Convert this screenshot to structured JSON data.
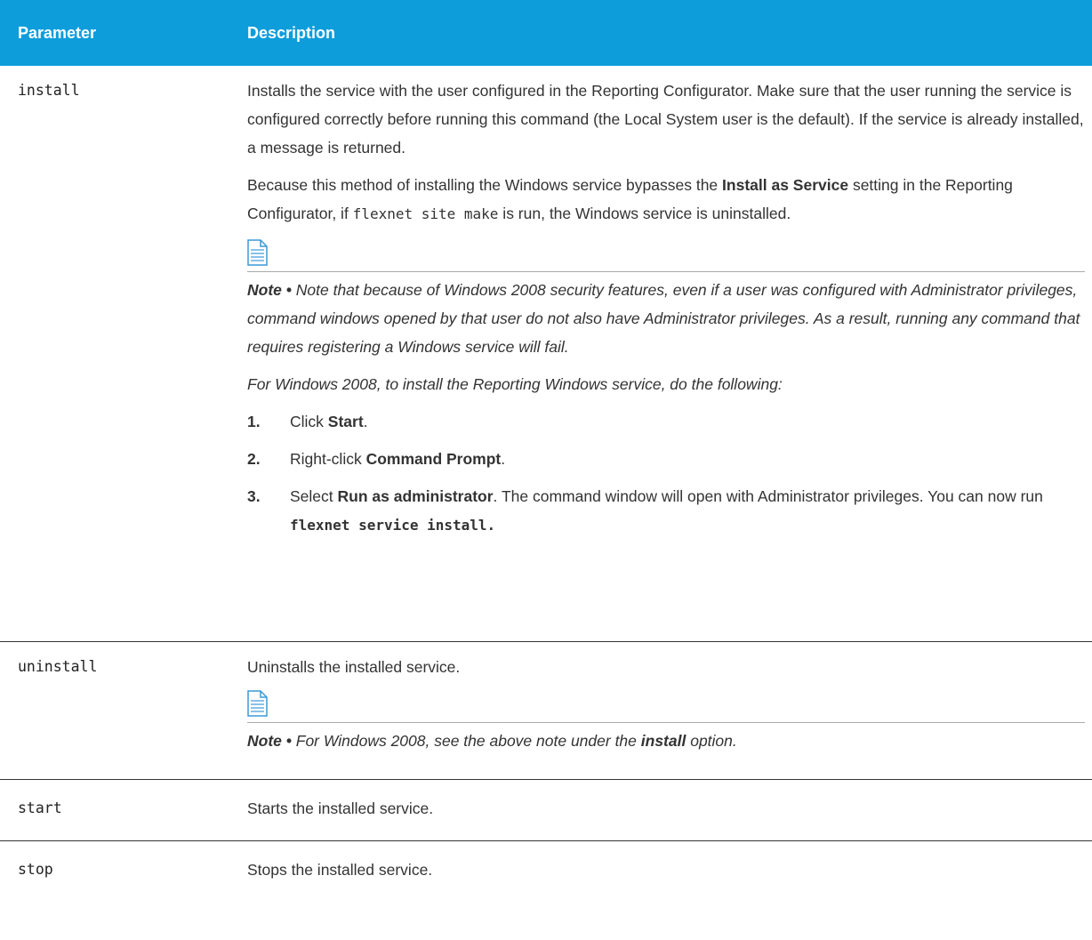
{
  "header": {
    "col1": "Parameter",
    "col2": "Description"
  },
  "rows": [
    {
      "param": "install",
      "p1": "Installs the service with the user configured in the Reporting Configurator. Make sure that the user running the service is configured correctly before running this command (the Local System user is the default). If the service is already installed, a message is returned.",
      "p2_a": "Because this method of installing the Windows service bypasses the ",
      "p2_b": "Install as Service",
      "p2_c": " setting in the Reporting Configurator, if ",
      "p2_code": "flexnet site make",
      "p2_d": " is run, the Windows service is uninstalled.",
      "note_label": "Note •",
      "note_text": " Note that because of Windows 2008 security features, even if a user was configured with Administrator privileges, command windows opened by that user do not also have Administrator privileges. As a result, running any command that requires registering a Windows service will fail.",
      "note_sub": "For Windows 2008, to install the Reporting Windows service, do the following:",
      "steps": [
        {
          "num": "1.",
          "a": "Click ",
          "b": "Start",
          "c": "."
        },
        {
          "num": "2.",
          "a": "Right-click ",
          "b": "Command Prompt",
          "c": "."
        },
        {
          "num": "3.",
          "a": "Select ",
          "b": "Run as administrator",
          "c": ". The command window will open with Administrator privileges. You can now run ",
          "code": "flexnet service install."
        }
      ]
    },
    {
      "param": "uninstall",
      "p1": "Uninstalls the installed service.",
      "note_label": "Note •",
      "note_a": " For Windows 2008, see the above note under the ",
      "note_b": "install",
      "note_c": " option."
    },
    {
      "param": "start",
      "p1": "Starts the installed service."
    },
    {
      "param": "stop",
      "p1": "Stops the installed service."
    }
  ],
  "icon_color": "#3a9ad9",
  "header_color": "#0d9ddb"
}
